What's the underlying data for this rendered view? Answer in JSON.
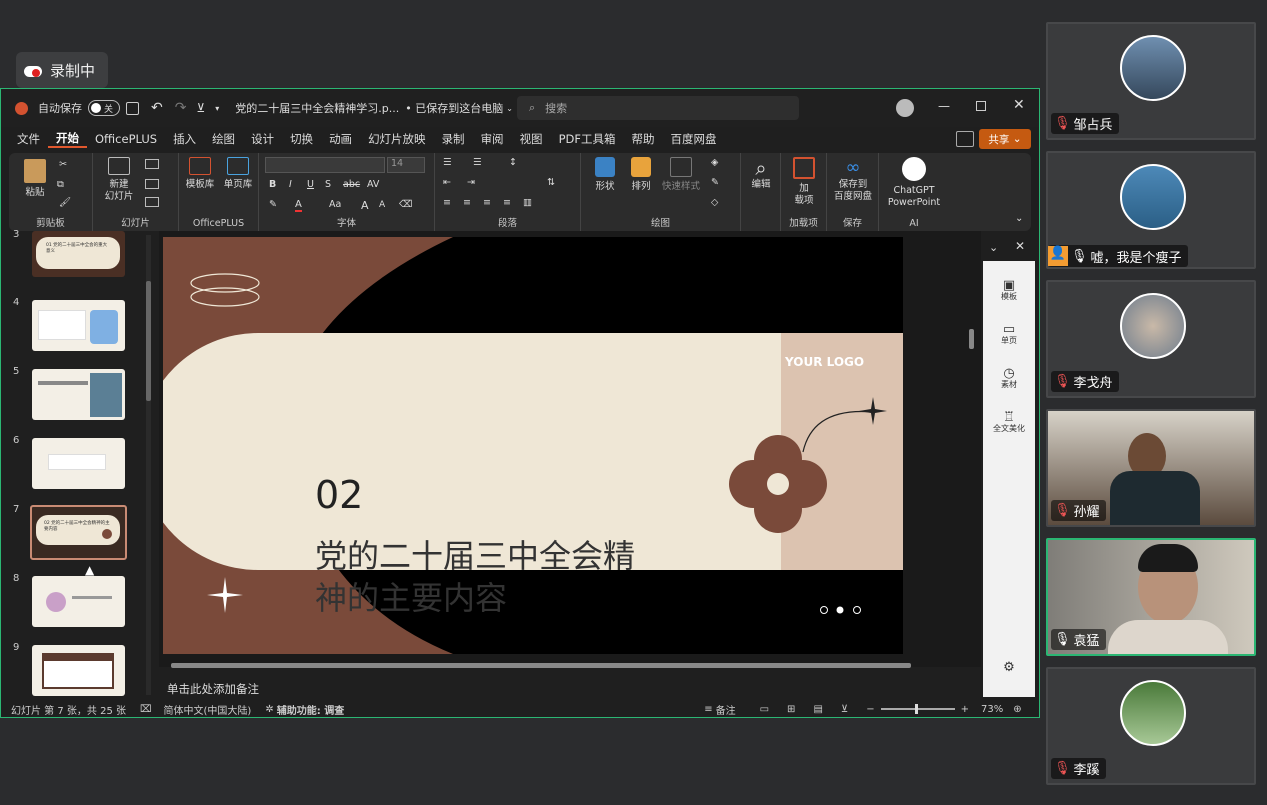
{
  "recording": {
    "label": "录制中"
  },
  "ppt": {
    "autosave_label": "自动保存",
    "autosave_state": "关",
    "doc_title": "党的二十届三中全会精神学习.p...",
    "save_status": "• 已保存到这台电脑",
    "search_placeholder": "搜索",
    "menu": [
      "文件",
      "开始",
      "OfficePLUS",
      "插入",
      "绘图",
      "设计",
      "切换",
      "动画",
      "幻灯片放映",
      "录制",
      "审阅",
      "视图",
      "PDF工具箱",
      "帮助",
      "百度网盘"
    ],
    "share_label": "共享",
    "ribbon": {
      "clipboard": {
        "paste": "粘贴",
        "group": "剪贴板"
      },
      "slides": {
        "new_slide_1": "新建",
        "new_slide_2": "幻灯片",
        "group": "幻灯片"
      },
      "officeplus": {
        "template": "模板库",
        "single": "单页库",
        "group": "OfficePLUS"
      },
      "font": {
        "size": "14",
        "group": "字体",
        "b": "B",
        "i": "I",
        "u": "U",
        "s": "S",
        "abc": "abc",
        "av": "AV",
        "aa": "Aa",
        "agrow": "A",
        "ashrink": "A"
      },
      "paragraph": {
        "group": "段落"
      },
      "drawing": {
        "shape": "形状",
        "arrange": "排列",
        "quick_style": "快速样式",
        "group": "绘图"
      },
      "edit": {
        "label": "编辑"
      },
      "addins": {
        "label_1": "加",
        "label_2": "载项",
        "group": "加载项"
      },
      "save": {
        "label_1": "保存到",
        "label_2": "百度网盘",
        "group": "保存"
      },
      "ai": {
        "label_1": "ChatGPT",
        "label_2": "PowerPoint",
        "group": "AI"
      }
    },
    "thumbs": [
      {
        "num": "3",
        "text": "01 党的二十届三中全会的重大意义"
      },
      {
        "num": "4",
        "text": ""
      },
      {
        "num": "5",
        "text": ""
      },
      {
        "num": "6",
        "text": ""
      },
      {
        "num": "7",
        "text": "02 党的二十届三中全会精神的主要内容"
      },
      {
        "num": "8",
        "text": ""
      },
      {
        "num": "9",
        "text": ""
      }
    ],
    "slide": {
      "logo": "YOUR LOGO",
      "number": "02",
      "title_1": "党的二十届三中全会精",
      "title_2": "神的主要内容"
    },
    "right_panel": [
      "模板",
      "单页",
      "素材",
      "全文美化"
    ],
    "notes_placeholder": "单击此处添加备注",
    "status": {
      "slide_pos": "幻灯片 第 7 张，共 25 张",
      "language": "简体中文(中国大陆)",
      "accessibility": "辅助功能: 调查",
      "notes": "备注",
      "zoom": "73%"
    }
  },
  "participants": [
    {
      "name": "邹占兵"
    },
    {
      "name": "嘘，我是个瘦子"
    },
    {
      "name": "李戈舟"
    },
    {
      "name": "孙耀"
    },
    {
      "name": "袁猛"
    },
    {
      "name": "李蹊"
    }
  ],
  "colors": {
    "accent": "#c55a11",
    "active_speaker": "#2bb673",
    "slide_brown": "#7a4a3a",
    "slide_cream": "#efe7d6"
  }
}
